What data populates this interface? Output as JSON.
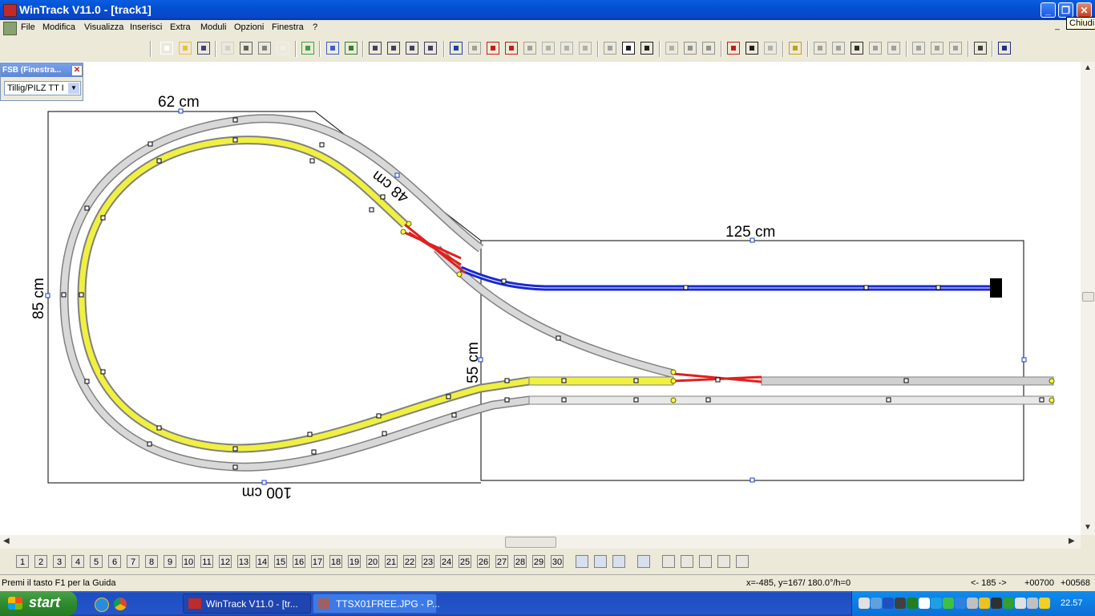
{
  "window": {
    "title": "WinTrack  V11.0 - [track1]"
  },
  "caption_buttons": {
    "minimize": "_",
    "restore": "❐",
    "close": "✕"
  },
  "tooltip": "Chiudi",
  "menu": {
    "items": [
      "File",
      "Modifica",
      "Visualizza",
      "Inserisci",
      "Extra",
      "Moduli",
      "Opzioni",
      "Finestra",
      "?"
    ]
  },
  "toolbar_icons": [
    "new-file-icon",
    "open-folder-icon",
    "save-icon",
    "print-preview-icon",
    "print-icon",
    "print-setup-icon",
    "page-icon",
    "library-icon",
    "settings-icon",
    "image-icon",
    "zoom-out-icon",
    "zoom-in-icon",
    "zoom-window-icon",
    "zoom-fit-icon",
    "undo-icon",
    "redo-icon",
    "module-icon",
    "module-edit-icon",
    "module-delete-icon",
    "cut-icon",
    "copy-icon",
    "paste-icon",
    "switch-icon",
    "curve-tool-icon",
    "flex-track-icon",
    "align-icon",
    "connect-icon",
    "disconnect-icon",
    "move-icon",
    "attach-icon",
    "rotate-icon",
    "height-icon",
    "signal-icon",
    "switch-left-icon",
    "crossing-icon",
    "track-split-icon",
    "junction-icon",
    "buffer-stop-icon",
    "bridge-icon",
    "tunnel-icon",
    "grid-icon",
    "help-icon"
  ],
  "fsb": {
    "title": "FSB (Finestra...",
    "close": "✕",
    "selected": "Tillig/PILZ  TT I"
  },
  "plan": {
    "dim_top_left": "62 cm",
    "dim_diagonal": "48 cm",
    "dim_left": "85 cm",
    "dim_bottom": "100 cm",
    "dim_right_top": "125 cm",
    "dim_middle": "55 cm"
  },
  "layers": {
    "first": "1",
    "items": [
      "2",
      "3",
      "4",
      "5",
      "6",
      "7",
      "8",
      "9",
      "10",
      "11",
      "12",
      "13",
      "14",
      "15",
      "16",
      "17",
      "18",
      "19",
      "20",
      "21",
      "22",
      "23",
      "24",
      "25",
      "26",
      "27",
      "28",
      "29",
      "30"
    ]
  },
  "layer_tools": [
    "layers-icon",
    "layer-edit-icon",
    "layer-clear-icon",
    "layers-set-icon",
    "page-1-icon",
    "page-2-icon",
    "page-3-icon",
    "page-4-icon",
    "page-5-icon"
  ],
  "status": {
    "help": "Premi il tasto F1 per la Guida",
    "coords": "x=-485, y=167/ 180.0°/h=0",
    "nav": "<- 185 ->",
    "val1": "+00700",
    "val2": "+00568"
  },
  "taskbar": {
    "start": "start",
    "tasks": [
      "WinTrack  V11.0 - [tr...",
      "TTSX01FREE.JPG - P..."
    ],
    "clock": "22.57"
  }
}
